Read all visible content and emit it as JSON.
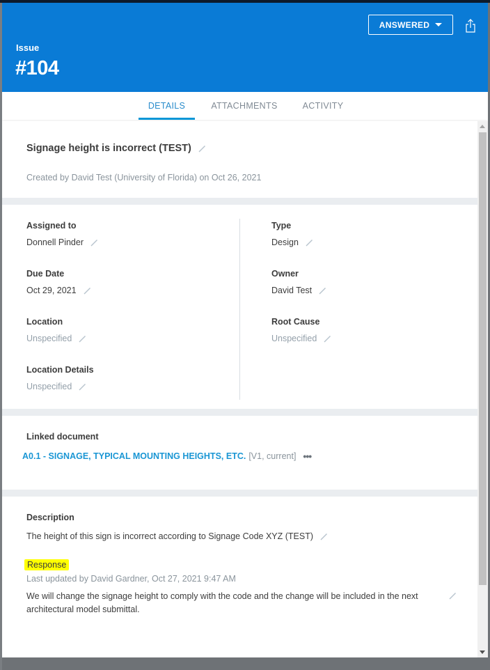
{
  "header": {
    "label": "Issue",
    "number": "#104",
    "status": "ANSWERED",
    "brand_color": "#0a7bd6"
  },
  "tabs": [
    {
      "label": "DETAILS",
      "active": true
    },
    {
      "label": "ATTACHMENTS",
      "active": false
    },
    {
      "label": "ACTIVITY",
      "active": false
    }
  ],
  "summary": {
    "title": "Signage height is incorrect (TEST)",
    "created": "Created by David Test (University of Florida) on Oct 26, 2021"
  },
  "fields": {
    "assigned_to": {
      "label": "Assigned to",
      "value": "Donnell Pinder"
    },
    "due_date": {
      "label": "Due Date",
      "value": "Oct 29, 2021"
    },
    "location": {
      "label": "Location",
      "value": "Unspecified"
    },
    "location_details": {
      "label": "Location Details",
      "value": "Unspecified"
    },
    "type": {
      "label": "Type",
      "value": "Design"
    },
    "owner": {
      "label": "Owner",
      "value": "David Test"
    },
    "root_cause": {
      "label": "Root Cause",
      "value": "Unspecified"
    }
  },
  "linked_document": {
    "label": "Linked document",
    "name": "A0.1 - SIGNAGE, TYPICAL MOUNTING HEIGHTS, ETC.",
    "version": "[V1, current]",
    "more": "•••"
  },
  "description": {
    "label": "Description",
    "text": "The height of this sign is incorrect according to Signage Code XYZ (TEST)"
  },
  "response": {
    "label": "Response",
    "updated": "Last updated by David Gardner, Oct 27, 2021 9:47 AM",
    "text": "We will change the signage height to comply with the code and the change will be included in the next architectural model submittal."
  }
}
